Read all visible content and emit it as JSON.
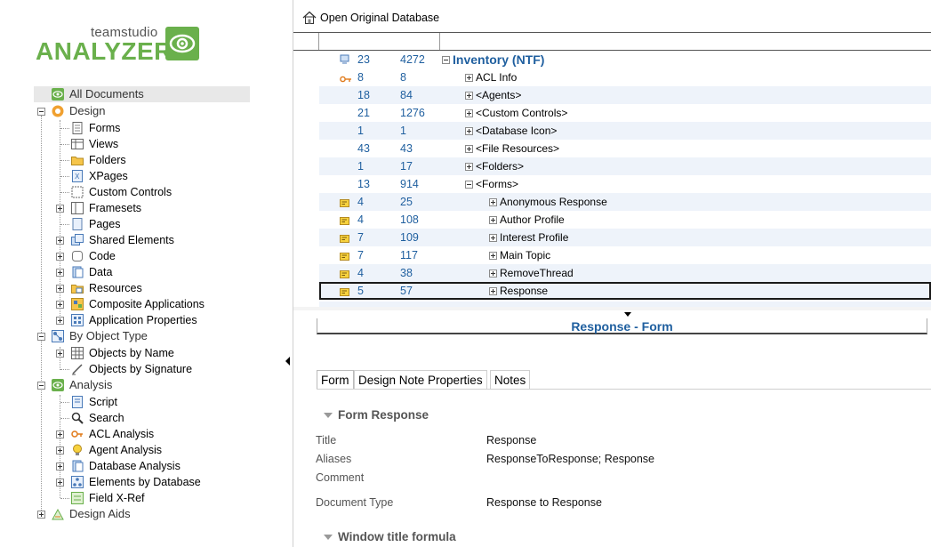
{
  "brand": {
    "small": "teamstudio",
    "big": "ANALYZER"
  },
  "tree": {
    "all_documents": "All Documents",
    "design": "Design",
    "forms": "Forms",
    "views": "Views",
    "folders": "Folders",
    "xpages": "XPages",
    "custom_controls": "Custom Controls",
    "framesets": "Framesets",
    "pages": "Pages",
    "shared_elements": "Shared Elements",
    "code": "Code",
    "data": "Data",
    "resources": "Resources",
    "composite_applications": "Composite Applications",
    "application_properties": "Application Properties",
    "by_object_type": "By Object Type",
    "objects_by_name": "Objects by Name",
    "objects_by_signature": "Objects by Signature",
    "analysis": "Analysis",
    "script": "Script",
    "search": "Search",
    "acl_analysis": "ACL Analysis",
    "agent_analysis": "Agent Analysis",
    "database_analysis": "Database Analysis",
    "elements_by_database": "Elements by Database",
    "field_xref": "Field X-Ref",
    "design_aids": "Design Aids"
  },
  "toolbar": {
    "open_original": "Open Original Database"
  },
  "grid": {
    "rows": [
      {
        "n1": "23",
        "n2": "4272",
        "name": "Inventory (NTF)"
      },
      {
        "n1": "8",
        "n2": "8",
        "name": "ACL Info"
      },
      {
        "n1": "18",
        "n2": "84",
        "name": "<Agents>"
      },
      {
        "n1": "21",
        "n2": "1276",
        "name": "<Custom Controls>"
      },
      {
        "n1": "1",
        "n2": "1",
        "name": "<Database Icon>"
      },
      {
        "n1": "43",
        "n2": "43",
        "name": "<File Resources>"
      },
      {
        "n1": "1",
        "n2": "17",
        "name": "<Folders>"
      },
      {
        "n1": "13",
        "n2": "914",
        "name": "<Forms>"
      },
      {
        "n1": "4",
        "n2": "25",
        "name": "Anonymous Response"
      },
      {
        "n1": "4",
        "n2": "108",
        "name": "Author Profile"
      },
      {
        "n1": "7",
        "n2": "109",
        "name": "Interest Profile"
      },
      {
        "n1": "7",
        "n2": "117",
        "name": "Main Topic"
      },
      {
        "n1": "4",
        "n2": "38",
        "name": "RemoveThread"
      },
      {
        "n1": "5",
        "n2": "57",
        "name": "Response"
      }
    ]
  },
  "detail": {
    "title": "Response - Form",
    "tabs": [
      "Form",
      "Design Note Properties",
      "Notes"
    ],
    "section_form_response": "Form Response",
    "section_window_title": "Window title formula",
    "props": {
      "title_label": "Title",
      "title_value": "Response",
      "aliases_label": "Aliases",
      "aliases_value": "ResponseToResponse; Response",
      "comment_label": "Comment",
      "doctype_label": "Document Type",
      "doctype_value": "Response to Response"
    }
  },
  "colors": {
    "brand_green": "#6ab04c",
    "link_blue": "#1f5f9f"
  }
}
